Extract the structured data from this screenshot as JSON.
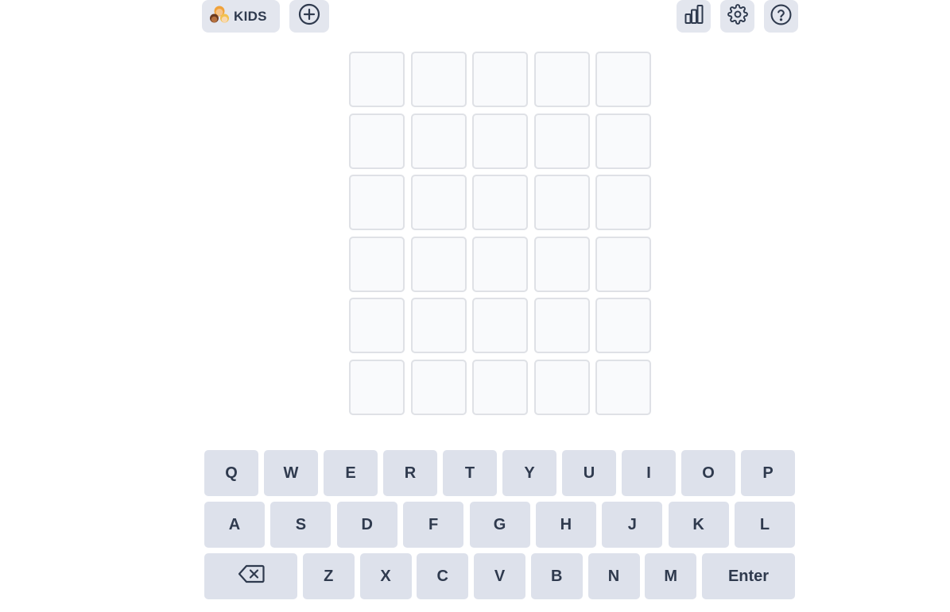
{
  "header": {
    "kids_label": "KIDS",
    "icons": {
      "kids": "kids-emoji-icon",
      "add": "plus-circle-icon",
      "stats": "bar-chart-icon",
      "settings": "gear-icon",
      "help": "question-circle-icon"
    }
  },
  "board": {
    "rows": 6,
    "cols": 5,
    "tiles": [
      [
        "",
        "",
        "",
        "",
        ""
      ],
      [
        "",
        "",
        "",
        "",
        ""
      ],
      [
        "",
        "",
        "",
        "",
        ""
      ],
      [
        "",
        "",
        "",
        "",
        ""
      ],
      [
        "",
        "",
        "",
        "",
        ""
      ],
      [
        "",
        "",
        "",
        "",
        ""
      ]
    ]
  },
  "keyboard": {
    "row1": [
      "Q",
      "W",
      "E",
      "R",
      "T",
      "Y",
      "U",
      "I",
      "O",
      "P"
    ],
    "row2": [
      "A",
      "S",
      "D",
      "F",
      "G",
      "H",
      "J",
      "K",
      "L"
    ],
    "row3": [
      "Z",
      "X",
      "C",
      "V",
      "B",
      "N",
      "M"
    ],
    "backspace_icon": "backspace-icon",
    "enter_label": "Enter"
  },
  "colors": {
    "key_bg": "#dde1eb",
    "text": "#2f3a4e",
    "tile_border": "#dfe1e6",
    "tile_bg": "#f9fafc"
  }
}
